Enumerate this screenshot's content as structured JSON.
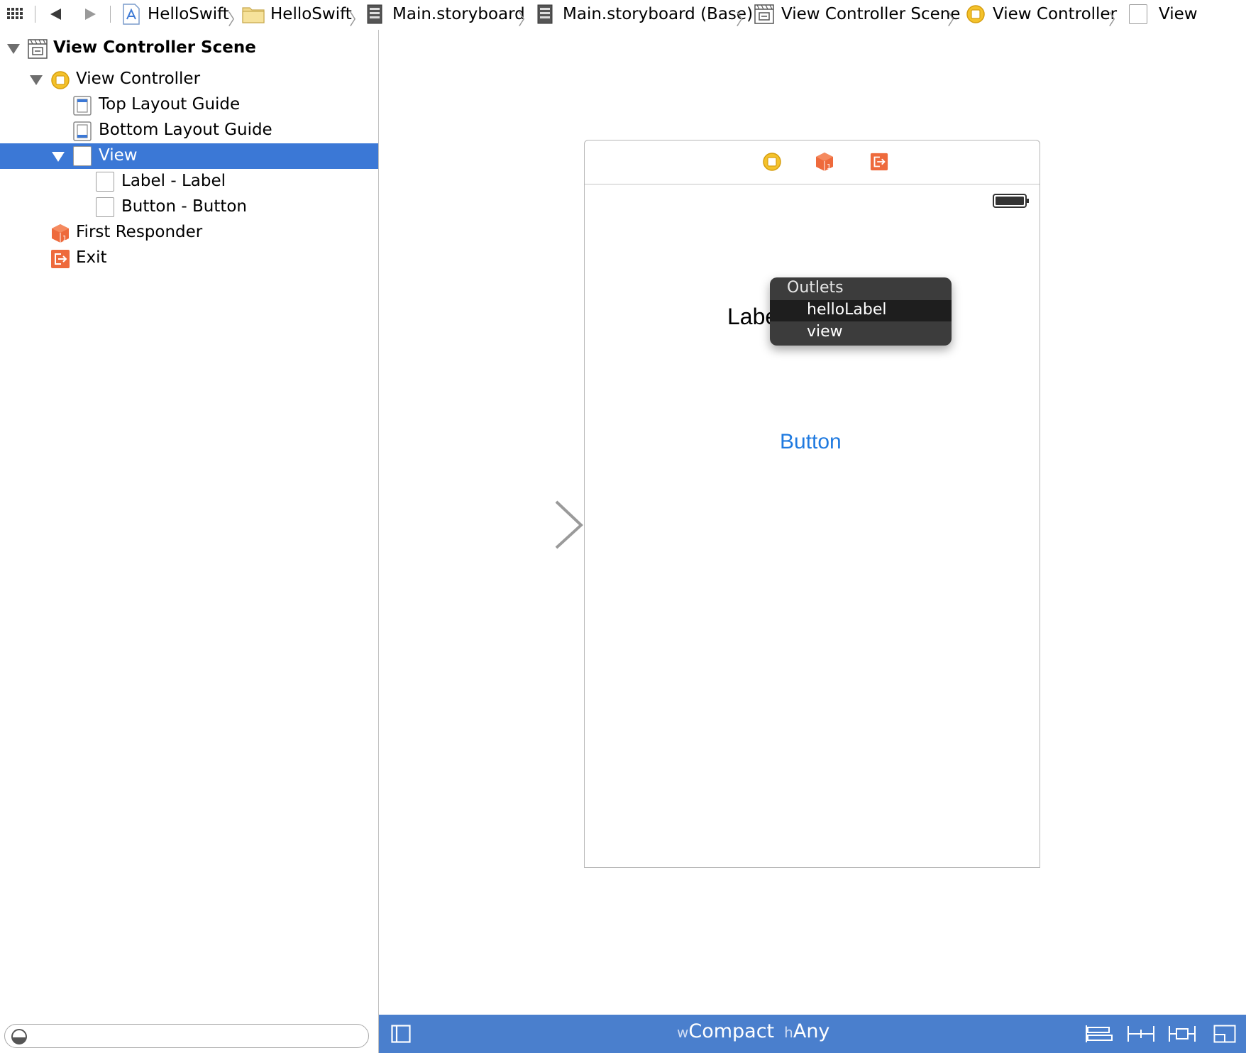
{
  "breadcrumb": {
    "items": [
      {
        "label": "HelloSwift",
        "icon": "project-icon"
      },
      {
        "label": "HelloSwift",
        "icon": "folder-icon"
      },
      {
        "label": "Main.storyboard",
        "icon": "storyboard-file-icon"
      },
      {
        "label": "Main.storyboard (Base)",
        "icon": "storyboard-file-icon"
      },
      {
        "label": "View Controller Scene",
        "icon": "scene-icon"
      },
      {
        "label": "View Controller",
        "icon": "view-controller-icon"
      },
      {
        "label": "View",
        "icon": "view-icon"
      }
    ]
  },
  "outline": {
    "items": [
      {
        "label": "View Controller Scene",
        "icon": "scene-icon",
        "expanded": true
      },
      {
        "label": "View Controller",
        "icon": "view-controller-icon",
        "expanded": true
      },
      {
        "label": "Top Layout Guide",
        "icon": "layout-guide-icon"
      },
      {
        "label": "Bottom Layout Guide",
        "icon": "layout-guide-icon"
      },
      {
        "label": "View",
        "icon": "view-icon",
        "expanded": true,
        "selected": true
      },
      {
        "label": "Label - Label",
        "icon": "view-icon"
      },
      {
        "label": "Button - Button",
        "icon": "view-icon"
      },
      {
        "label": "First Responder",
        "icon": "first-responder-icon"
      },
      {
        "label": "Exit",
        "icon": "exit-icon"
      }
    ]
  },
  "canvas": {
    "label_text": "Label",
    "button_text": "Button",
    "popup": {
      "header": "Outlets",
      "options": [
        "helloLabel",
        "view"
      ],
      "highlighted": "helloLabel"
    }
  },
  "bottombar": {
    "w_prefix": "w",
    "w_value": "Compact",
    "h_prefix": "h",
    "h_value": "Any"
  },
  "colors": {
    "selection": "#3b78d6",
    "bottombar": "#4a7fcd",
    "button_tint": "#1f7ae0",
    "popup_bg": "#3c3c3c",
    "orange": "#ee6a3c",
    "vc_yellow": "#f4c22b"
  }
}
